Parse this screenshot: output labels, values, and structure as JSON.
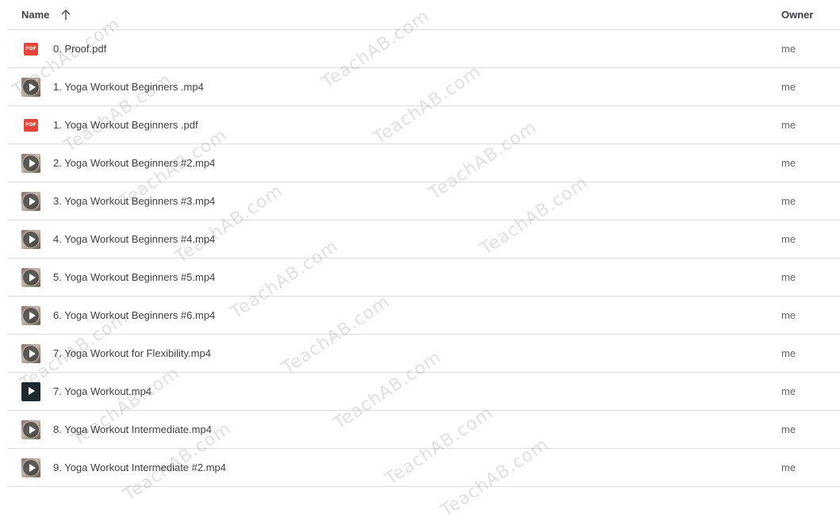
{
  "header": {
    "name_label": "Name",
    "owner_label": "Owner",
    "sort_icon": "arrow-upward-icon"
  },
  "files": [
    {
      "name": "0. Proof.pdf",
      "owner": "me",
      "type": "pdf"
    },
    {
      "name": "1. Yoga Workout Beginners .mp4",
      "owner": "me",
      "type": "video"
    },
    {
      "name": "1. Yoga Workout Beginners .pdf",
      "owner": "me",
      "type": "pdf"
    },
    {
      "name": "2. Yoga Workout Beginners #2.mp4",
      "owner": "me",
      "type": "video"
    },
    {
      "name": "3. Yoga Workout Beginners #3.mp4",
      "owner": "me",
      "type": "video"
    },
    {
      "name": "4. Yoga Workout Beginners #4.mp4",
      "owner": "me",
      "type": "video"
    },
    {
      "name": "5. Yoga Workout Beginners #5.mp4",
      "owner": "me",
      "type": "video"
    },
    {
      "name": "6. Yoga Workout Beginners #6.mp4",
      "owner": "me",
      "type": "video"
    },
    {
      "name": "7. Yoga Workout for Flexibility.mp4",
      "owner": "me",
      "type": "video"
    },
    {
      "name": "7. Yoga Workout.mp4",
      "owner": "me",
      "type": "video-dark"
    },
    {
      "name": "8. Yoga Workout Intermediate.mp4",
      "owner": "me",
      "type": "video"
    },
    {
      "name": "9. Yoga Workout Intermediate #2.mp4",
      "owner": "me",
      "type": "video"
    }
  ],
  "icons": {
    "pdf": "pdf-file-icon",
    "video": "video-thumbnail-icon",
    "pdf_label": "PDF"
  },
  "watermark": "TeachAB.com",
  "colors": {
    "pdf_red": "#ea4335",
    "divider": "#dadce0",
    "text": "#3c4043"
  }
}
